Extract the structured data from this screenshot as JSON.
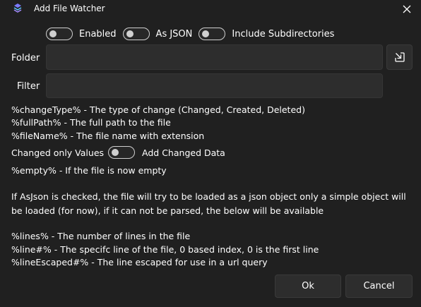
{
  "window": {
    "title": "Add File Watcher"
  },
  "options": {
    "enabled": {
      "label": "Enabled",
      "on": false
    },
    "as_json": {
      "label": "As JSON",
      "on": false
    },
    "include_subdirectories": {
      "label": "Include Subdirectories",
      "on": false
    }
  },
  "form": {
    "folder_label": "Folder",
    "folder_value": "",
    "filter_label": "Filter",
    "filter_value": ""
  },
  "help": {
    "change_type": "%changeType% - The type of change (Changed, Created, Deleted)",
    "full_path": "%fullPath% - The full path to the file",
    "file_name": "%fileName% - The file name with extension",
    "changed_only_values_label": "Changed only Values",
    "changed_only_values_on": false,
    "add_changed_data_label": "Add Changed Data",
    "empty": "%empty% - If the file is now empty",
    "as_json_note": "If AsJson is checked, the file will try to be loaded as a json object only a simple object will be loaded (for now), if it can not be parsed, the below will be available",
    "lines": "%lines% - The number of lines in the file",
    "line_n": "%line#% - The specifc line of the file, 0 based index, 0 is the first line",
    "line_escaped": "%lineEscaped#% - The line escaped for use in a url query"
  },
  "buttons": {
    "ok": "Ok",
    "cancel": "Cancel"
  },
  "icons": {
    "app": "app-logo-icon",
    "close": "close-icon",
    "browse": "browse-folder-icon"
  },
  "colors": {
    "background": "#202020",
    "input": "#2d2d2d",
    "accent": "#8a86ff"
  }
}
